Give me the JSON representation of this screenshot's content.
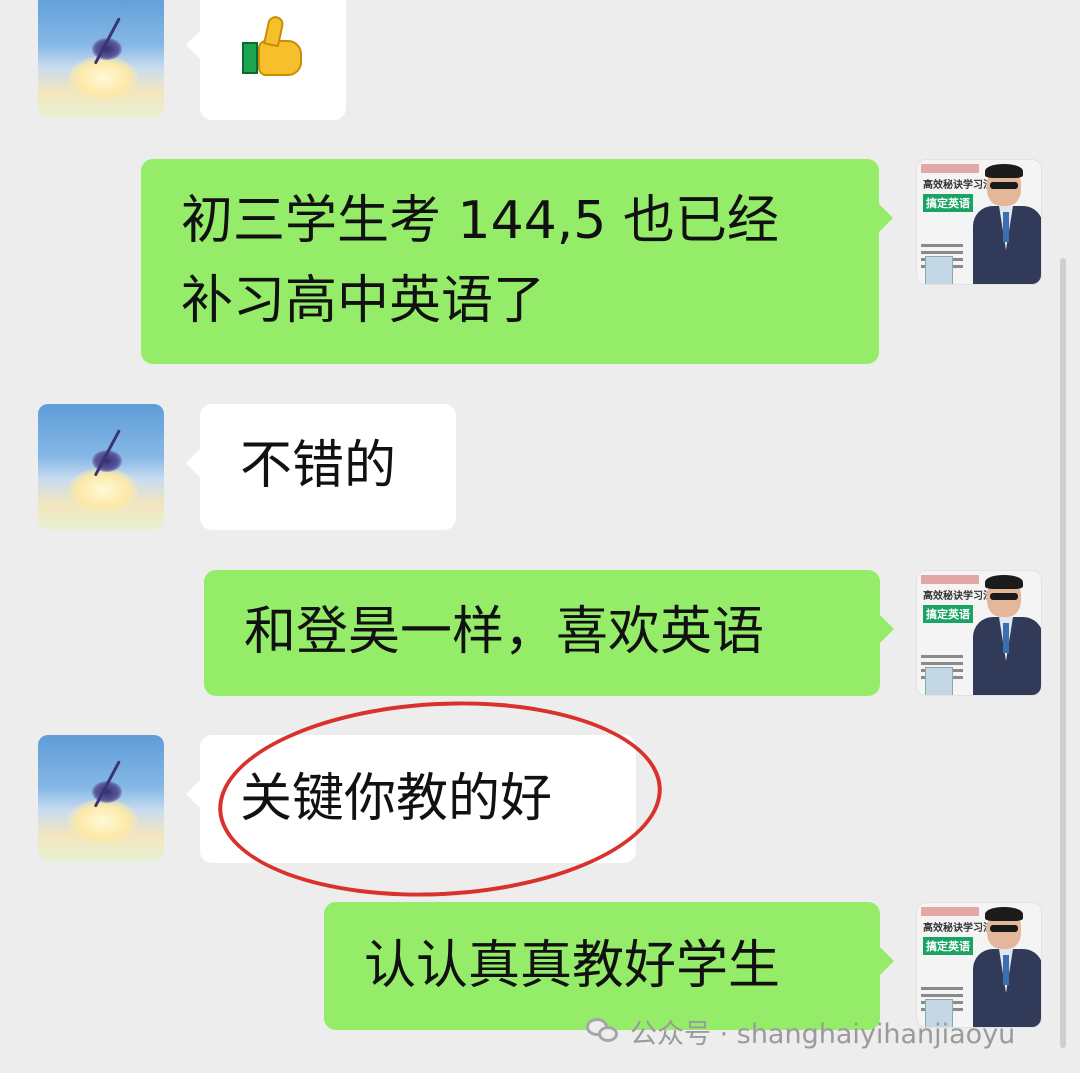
{
  "chat": {
    "messages": [
      {
        "sender": "other",
        "type": "emoji",
        "emoji": "thumbs-up-icon"
      },
      {
        "sender": "self",
        "type": "text",
        "text": "初三学生考 144,5 也已经\n补习高中英语了"
      },
      {
        "sender": "other",
        "type": "text",
        "text": "不错的"
      },
      {
        "sender": "self",
        "type": "text",
        "text": "和登昊一样，喜欢英语"
      },
      {
        "sender": "other",
        "type": "text",
        "text": "关键你教的好",
        "highlighted": true
      },
      {
        "sender": "self",
        "type": "text",
        "text": "认认真真教好学生"
      }
    ]
  },
  "self_avatar": {
    "subtitle": "高效秘诀学习法",
    "tag": "搞定英语"
  },
  "watermark": {
    "text": "公众号 · shanghaiyihanjiaoyu"
  },
  "colors": {
    "background": "#ededed",
    "self_bubble": "#95ec69",
    "other_bubble": "#ffffff",
    "highlight_ring": "#d9312c"
  }
}
